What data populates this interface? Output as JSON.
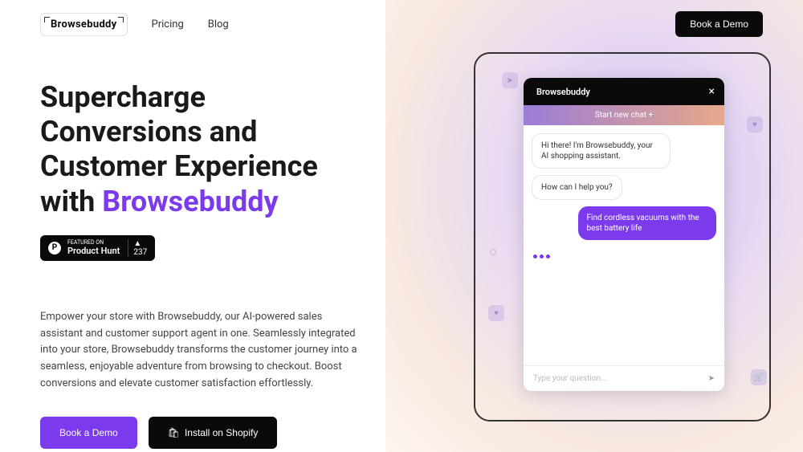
{
  "brand": "Browsebuddy",
  "nav": {
    "pricing": "Pricing",
    "blog": "Blog"
  },
  "header_cta": "Book a Demo",
  "hero": {
    "title_a": "Supercharge Conversions and Customer Experience with ",
    "title_b": "Browsebuddy",
    "desc": "Empower your store with Browsebuddy, our AI-powered sales assistant and customer support agent in one. Seamlessly integrated into your store, Browsebuddy transforms the customer journey into a seamless, enjoyable adventure from browsing to checkout. Boost conversions and elevate customer satisfaction effortlessly.",
    "cta_primary": "Book a Demo",
    "cta_secondary": "Install on Shopify"
  },
  "ph": {
    "featured": "FEATURED ON",
    "name": "Product Hunt",
    "count": "237"
  },
  "chat": {
    "brand": "Browsebuddy",
    "close": "×",
    "new_chat": "Start new chat  +",
    "bot1": "Hi there! I'm Browsebuddy, your AI shopping assistant.",
    "bot2": "How can I help you?",
    "user1": "Find cordless vacuums with the best battery life",
    "placeholder": "Type your question...",
    "send": "➤"
  }
}
